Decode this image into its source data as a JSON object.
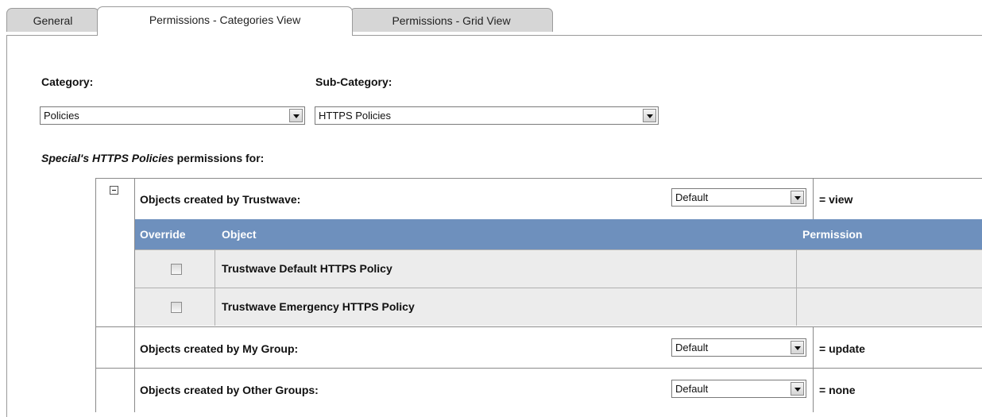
{
  "tabs": {
    "general": "General",
    "categories_view": "Permissions - Categories View",
    "grid_view": "Permissions - Grid View"
  },
  "category": {
    "label": "Category:",
    "value": "Policies"
  },
  "subcategory": {
    "label": "Sub-Category:",
    "value": "HTTPS Policies"
  },
  "subtitle": {
    "part1": "Special's HTTPS Policies",
    "part2": " permissions for:"
  },
  "groups": [
    {
      "label": "Objects created by Trustwave:",
      "select": "Default",
      "result": "= view"
    },
    {
      "label": "Objects created by My Group:",
      "select": "Default",
      "result": "= update"
    },
    {
      "label": "Objects created by Other Groups:",
      "select": "Default",
      "result": "= none"
    }
  ],
  "objects_table": {
    "headers": {
      "override": "Override",
      "object": "Object",
      "permission": "Permission"
    },
    "rows": [
      {
        "object": "Trustwave Default HTTPS Policy",
        "permission": ""
      },
      {
        "object": "Trustwave Emergency HTTPS Policy",
        "permission": ""
      }
    ]
  },
  "colors": {
    "header_bg": "#6e90bd",
    "row_bg": "#ececec",
    "tab_bg": "#d6d6d6"
  }
}
